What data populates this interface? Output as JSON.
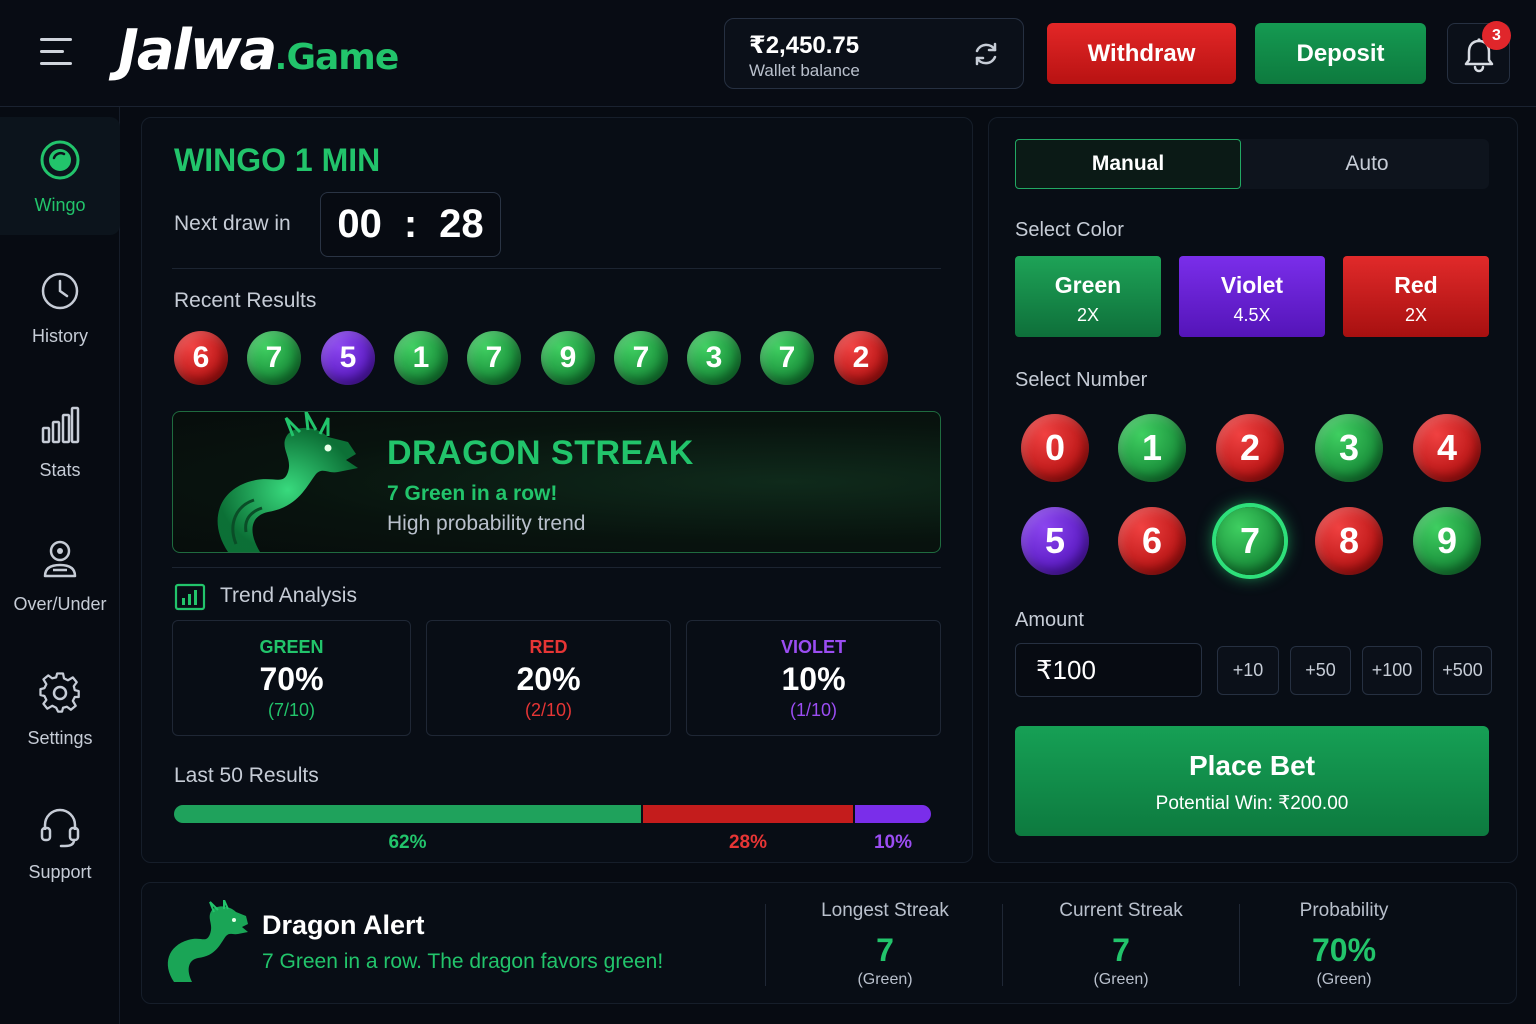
{
  "header": {
    "logo_main": "Jalwa",
    "logo_dot": ".",
    "logo_sub": "Game",
    "wallet_amount": "₹2,450.75",
    "wallet_label": "Wallet balance",
    "withdraw_label": "Withdraw",
    "deposit_label": "Deposit",
    "notification_count": "3",
    "icons": [
      "menu-icon",
      "refresh-icon",
      "bell-icon"
    ]
  },
  "sidebar": {
    "items": [
      {
        "label": "Wingo",
        "icon": "wingo-icon",
        "active": true
      },
      {
        "label": "History",
        "icon": "clock-icon",
        "active": false
      },
      {
        "label": "Stats",
        "icon": "bar-chart-icon",
        "active": false
      },
      {
        "label": "Over/Under",
        "icon": "user-target-icon",
        "active": false
      },
      {
        "label": "Settings",
        "icon": "gear-icon",
        "active": false
      },
      {
        "label": "Support",
        "icon": "headset-icon",
        "active": false
      }
    ]
  },
  "game": {
    "title": "WINGO 1 MIN",
    "next_draw_label": "Next draw in",
    "timer_min": "00",
    "timer_sep": ":",
    "timer_sec": "28",
    "recent_label": "Recent Results",
    "recent_results": [
      {
        "n": "6",
        "color": "red"
      },
      {
        "n": "7",
        "color": "green"
      },
      {
        "n": "5",
        "color": "violet"
      },
      {
        "n": "1",
        "color": "green"
      },
      {
        "n": "7",
        "color": "green"
      },
      {
        "n": "9",
        "color": "green"
      },
      {
        "n": "7",
        "color": "green"
      },
      {
        "n": "3",
        "color": "green"
      },
      {
        "n": "7",
        "color": "green"
      },
      {
        "n": "2",
        "color": "red"
      }
    ]
  },
  "streak": {
    "title": "DRAGON STREAK",
    "subtitle": "7 Green in a row!",
    "description": "High probability trend"
  },
  "trend": {
    "label": "Trend Analysis",
    "boxes": [
      {
        "name": "GREEN",
        "pct": "70%",
        "count": "(7/10)",
        "color": "#22c46b"
      },
      {
        "name": "RED",
        "pct": "20%",
        "count": "(2/10)",
        "color": "#e63535"
      },
      {
        "name": "VIOLET",
        "pct": "10%",
        "count": "(1/10)",
        "color": "#9b4df2"
      }
    ]
  },
  "last50": {
    "label": "Last 50 Results",
    "segments": [
      {
        "label": "62%",
        "value": 62,
        "color": "#1fa25c"
      },
      {
        "label": "28%",
        "value": 28,
        "color": "#c41c1c"
      },
      {
        "label": "10%",
        "value": 10,
        "color": "#7a2eea"
      }
    ]
  },
  "bet": {
    "tab_manual": "Manual",
    "tab_auto": "Auto",
    "select_color_label": "Select Color",
    "colors": [
      {
        "name": "Green",
        "mult": "2X"
      },
      {
        "name": "Violet",
        "mult": "4.5X"
      },
      {
        "name": "Red",
        "mult": "2X"
      }
    ],
    "select_number_label": "Select Number",
    "numbers": [
      {
        "n": "0",
        "color": "red"
      },
      {
        "n": "1",
        "color": "green"
      },
      {
        "n": "2",
        "color": "red"
      },
      {
        "n": "3",
        "color": "green"
      },
      {
        "n": "4",
        "color": "red"
      },
      {
        "n": "5",
        "color": "violet"
      },
      {
        "n": "6",
        "color": "red"
      },
      {
        "n": "7",
        "color": "green",
        "selected": true
      },
      {
        "n": "8",
        "color": "red"
      },
      {
        "n": "9",
        "color": "green"
      }
    ],
    "amount_label": "Amount",
    "amount_value": "₹100",
    "chips": [
      "+10",
      "+50",
      "+100",
      "+500"
    ],
    "place_bet_label": "Place Bet",
    "potential_win": "Potential Win: ₹200.00"
  },
  "alert": {
    "title": "Dragon Alert",
    "subtitle": "7 Green in a row. The dragon favors green!",
    "stats": [
      {
        "title": "Longest Streak",
        "value": "7",
        "note": "(Green)"
      },
      {
        "title": "Current Streak",
        "value": "7",
        "note": "(Green)"
      },
      {
        "title": "Probability",
        "value": "70%",
        "note": "(Green)"
      }
    ]
  }
}
